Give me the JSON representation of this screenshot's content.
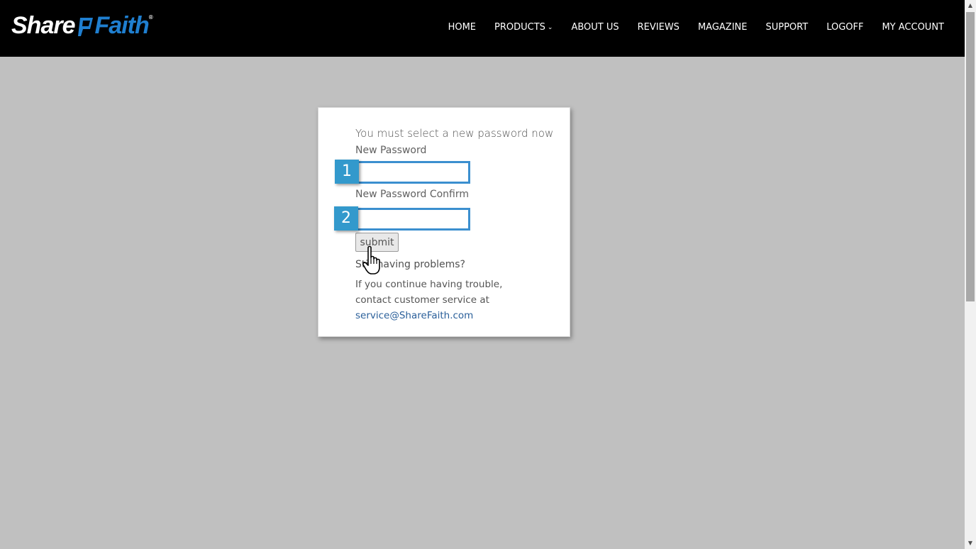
{
  "header": {
    "logo_left": "Share",
    "logo_right": "Faith",
    "logo_tm": "®",
    "nav": [
      {
        "label": "HOME"
      },
      {
        "label": "PRODUCTS",
        "has_dropdown": true
      },
      {
        "label": "ABOUT US"
      },
      {
        "label": "REVIEWS"
      },
      {
        "label": "MAGAZINE"
      },
      {
        "label": "SUPPORT"
      },
      {
        "label": "LOGOFF"
      },
      {
        "label": "MY ACCOUNT"
      }
    ],
    "dropdown_icon": "chevron-down-icon"
  },
  "form": {
    "title": "You must select a new password now",
    "new_password_label": "New Password",
    "new_password_value": "",
    "confirm_label": "New Password Confirm",
    "confirm_value": "",
    "submit_label": "submit",
    "problems_text": "Still having problems?",
    "help_line1": "If you continue having trouble,",
    "help_line2": "contact customer service at",
    "email": "service@ShareFaith.com"
  },
  "annotations": {
    "step1": "1",
    "step2": "2"
  },
  "colors": {
    "header_bg": "#000000",
    "page_bg": "#c0c0c0",
    "accent": "#3399cc",
    "link": "#2a5f9a"
  }
}
